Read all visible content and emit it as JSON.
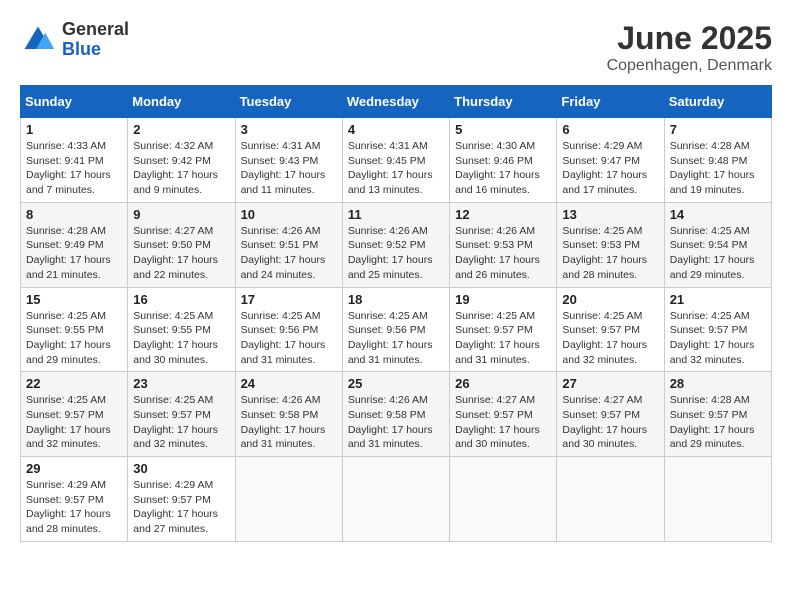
{
  "logo": {
    "general": "General",
    "blue": "Blue"
  },
  "title": {
    "month": "June 2025",
    "location": "Copenhagen, Denmark"
  },
  "headers": [
    "Sunday",
    "Monday",
    "Tuesday",
    "Wednesday",
    "Thursday",
    "Friday",
    "Saturday"
  ],
  "weeks": [
    [
      {
        "day": "1",
        "info": "Sunrise: 4:33 AM\nSunset: 9:41 PM\nDaylight: 17 hours and 7 minutes."
      },
      {
        "day": "2",
        "info": "Sunrise: 4:32 AM\nSunset: 9:42 PM\nDaylight: 17 hours and 9 minutes."
      },
      {
        "day": "3",
        "info": "Sunrise: 4:31 AM\nSunset: 9:43 PM\nDaylight: 17 hours and 11 minutes."
      },
      {
        "day": "4",
        "info": "Sunrise: 4:31 AM\nSunset: 9:45 PM\nDaylight: 17 hours and 13 minutes."
      },
      {
        "day": "5",
        "info": "Sunrise: 4:30 AM\nSunset: 9:46 PM\nDaylight: 17 hours and 16 minutes."
      },
      {
        "day": "6",
        "info": "Sunrise: 4:29 AM\nSunset: 9:47 PM\nDaylight: 17 hours and 17 minutes."
      },
      {
        "day": "7",
        "info": "Sunrise: 4:28 AM\nSunset: 9:48 PM\nDaylight: 17 hours and 19 minutes."
      }
    ],
    [
      {
        "day": "8",
        "info": "Sunrise: 4:28 AM\nSunset: 9:49 PM\nDaylight: 17 hours and 21 minutes."
      },
      {
        "day": "9",
        "info": "Sunrise: 4:27 AM\nSunset: 9:50 PM\nDaylight: 17 hours and 22 minutes."
      },
      {
        "day": "10",
        "info": "Sunrise: 4:26 AM\nSunset: 9:51 PM\nDaylight: 17 hours and 24 minutes."
      },
      {
        "day": "11",
        "info": "Sunrise: 4:26 AM\nSunset: 9:52 PM\nDaylight: 17 hours and 25 minutes."
      },
      {
        "day": "12",
        "info": "Sunrise: 4:26 AM\nSunset: 9:53 PM\nDaylight: 17 hours and 26 minutes."
      },
      {
        "day": "13",
        "info": "Sunrise: 4:25 AM\nSunset: 9:53 PM\nDaylight: 17 hours and 28 minutes."
      },
      {
        "day": "14",
        "info": "Sunrise: 4:25 AM\nSunset: 9:54 PM\nDaylight: 17 hours and 29 minutes."
      }
    ],
    [
      {
        "day": "15",
        "info": "Sunrise: 4:25 AM\nSunset: 9:55 PM\nDaylight: 17 hours and 29 minutes."
      },
      {
        "day": "16",
        "info": "Sunrise: 4:25 AM\nSunset: 9:55 PM\nDaylight: 17 hours and 30 minutes."
      },
      {
        "day": "17",
        "info": "Sunrise: 4:25 AM\nSunset: 9:56 PM\nDaylight: 17 hours and 31 minutes."
      },
      {
        "day": "18",
        "info": "Sunrise: 4:25 AM\nSunset: 9:56 PM\nDaylight: 17 hours and 31 minutes."
      },
      {
        "day": "19",
        "info": "Sunrise: 4:25 AM\nSunset: 9:57 PM\nDaylight: 17 hours and 31 minutes."
      },
      {
        "day": "20",
        "info": "Sunrise: 4:25 AM\nSunset: 9:57 PM\nDaylight: 17 hours and 32 minutes."
      },
      {
        "day": "21",
        "info": "Sunrise: 4:25 AM\nSunset: 9:57 PM\nDaylight: 17 hours and 32 minutes."
      }
    ],
    [
      {
        "day": "22",
        "info": "Sunrise: 4:25 AM\nSunset: 9:57 PM\nDaylight: 17 hours and 32 minutes."
      },
      {
        "day": "23",
        "info": "Sunrise: 4:25 AM\nSunset: 9:57 PM\nDaylight: 17 hours and 32 minutes."
      },
      {
        "day": "24",
        "info": "Sunrise: 4:26 AM\nSunset: 9:58 PM\nDaylight: 17 hours and 31 minutes."
      },
      {
        "day": "25",
        "info": "Sunrise: 4:26 AM\nSunset: 9:58 PM\nDaylight: 17 hours and 31 minutes."
      },
      {
        "day": "26",
        "info": "Sunrise: 4:27 AM\nSunset: 9:57 PM\nDaylight: 17 hours and 30 minutes."
      },
      {
        "day": "27",
        "info": "Sunrise: 4:27 AM\nSunset: 9:57 PM\nDaylight: 17 hours and 30 minutes."
      },
      {
        "day": "28",
        "info": "Sunrise: 4:28 AM\nSunset: 9:57 PM\nDaylight: 17 hours and 29 minutes."
      }
    ],
    [
      {
        "day": "29",
        "info": "Sunrise: 4:29 AM\nSunset: 9:57 PM\nDaylight: 17 hours and 28 minutes."
      },
      {
        "day": "30",
        "info": "Sunrise: 4:29 AM\nSunset: 9:57 PM\nDaylight: 17 hours and 27 minutes."
      },
      {
        "day": "",
        "info": ""
      },
      {
        "day": "",
        "info": ""
      },
      {
        "day": "",
        "info": ""
      },
      {
        "day": "",
        "info": ""
      },
      {
        "day": "",
        "info": ""
      }
    ]
  ]
}
